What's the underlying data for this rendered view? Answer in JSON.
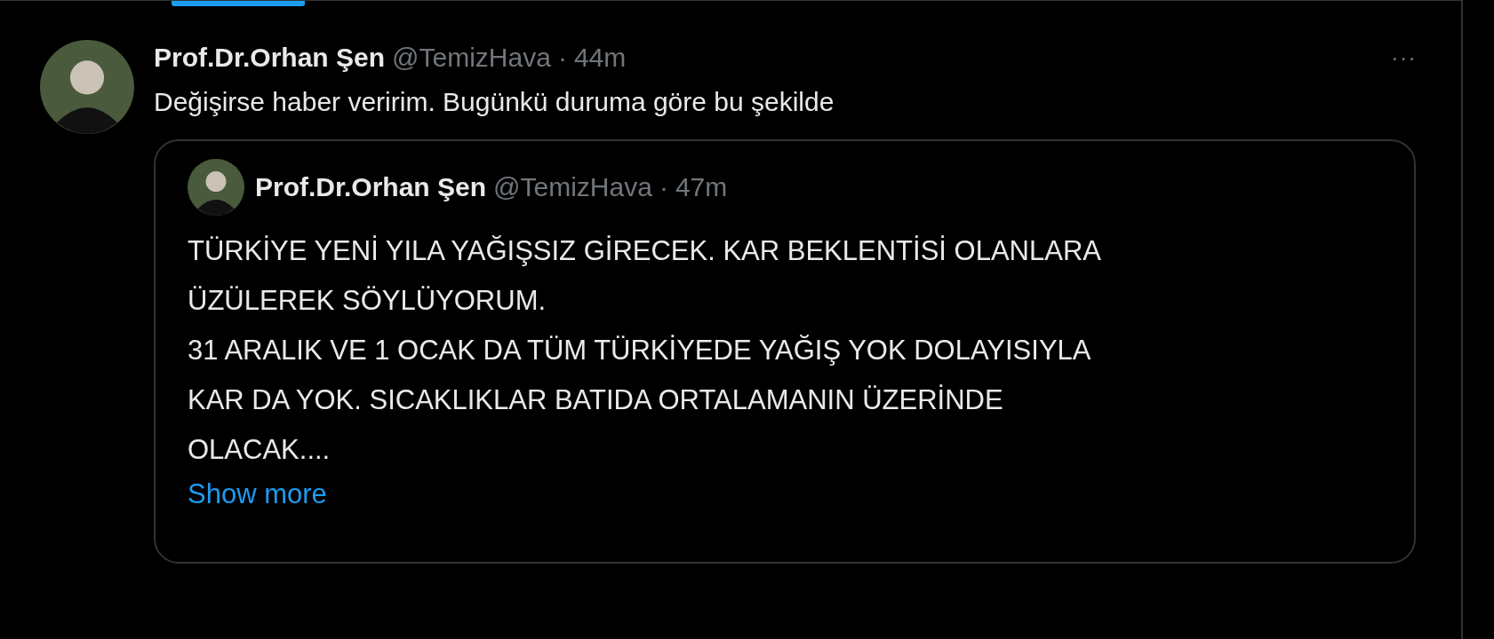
{
  "tweet": {
    "author": "Prof.Dr.Orhan Şen",
    "handle": "@TemizHava",
    "separator": "·",
    "time": "44m",
    "more": "···",
    "text": "Değişirse haber veririm. Bugünkü duruma göre bu şekilde",
    "quote": {
      "author": "Prof.Dr.Orhan Şen",
      "handle": "@TemizHava",
      "separator": "·",
      "time": "47m",
      "lines": [
        "TÜRKİYE YENİ YILA YAĞIŞSIZ GİRECEK. KAR BEKLENTİSİ OLANLARA",
        "ÜZÜLEREK SÖYLÜYORUM.",
        "31 ARALIK VE 1 OCAK DA TÜM TÜRKİYEDE YAĞIŞ YOK DOLAYISIYLA",
        "KAR DA YOK. SICAKLIKLAR BATIDA ORTALAMANIN ÜZERİNDE",
        "OLACAK...."
      ],
      "show_more": "Show more"
    }
  }
}
